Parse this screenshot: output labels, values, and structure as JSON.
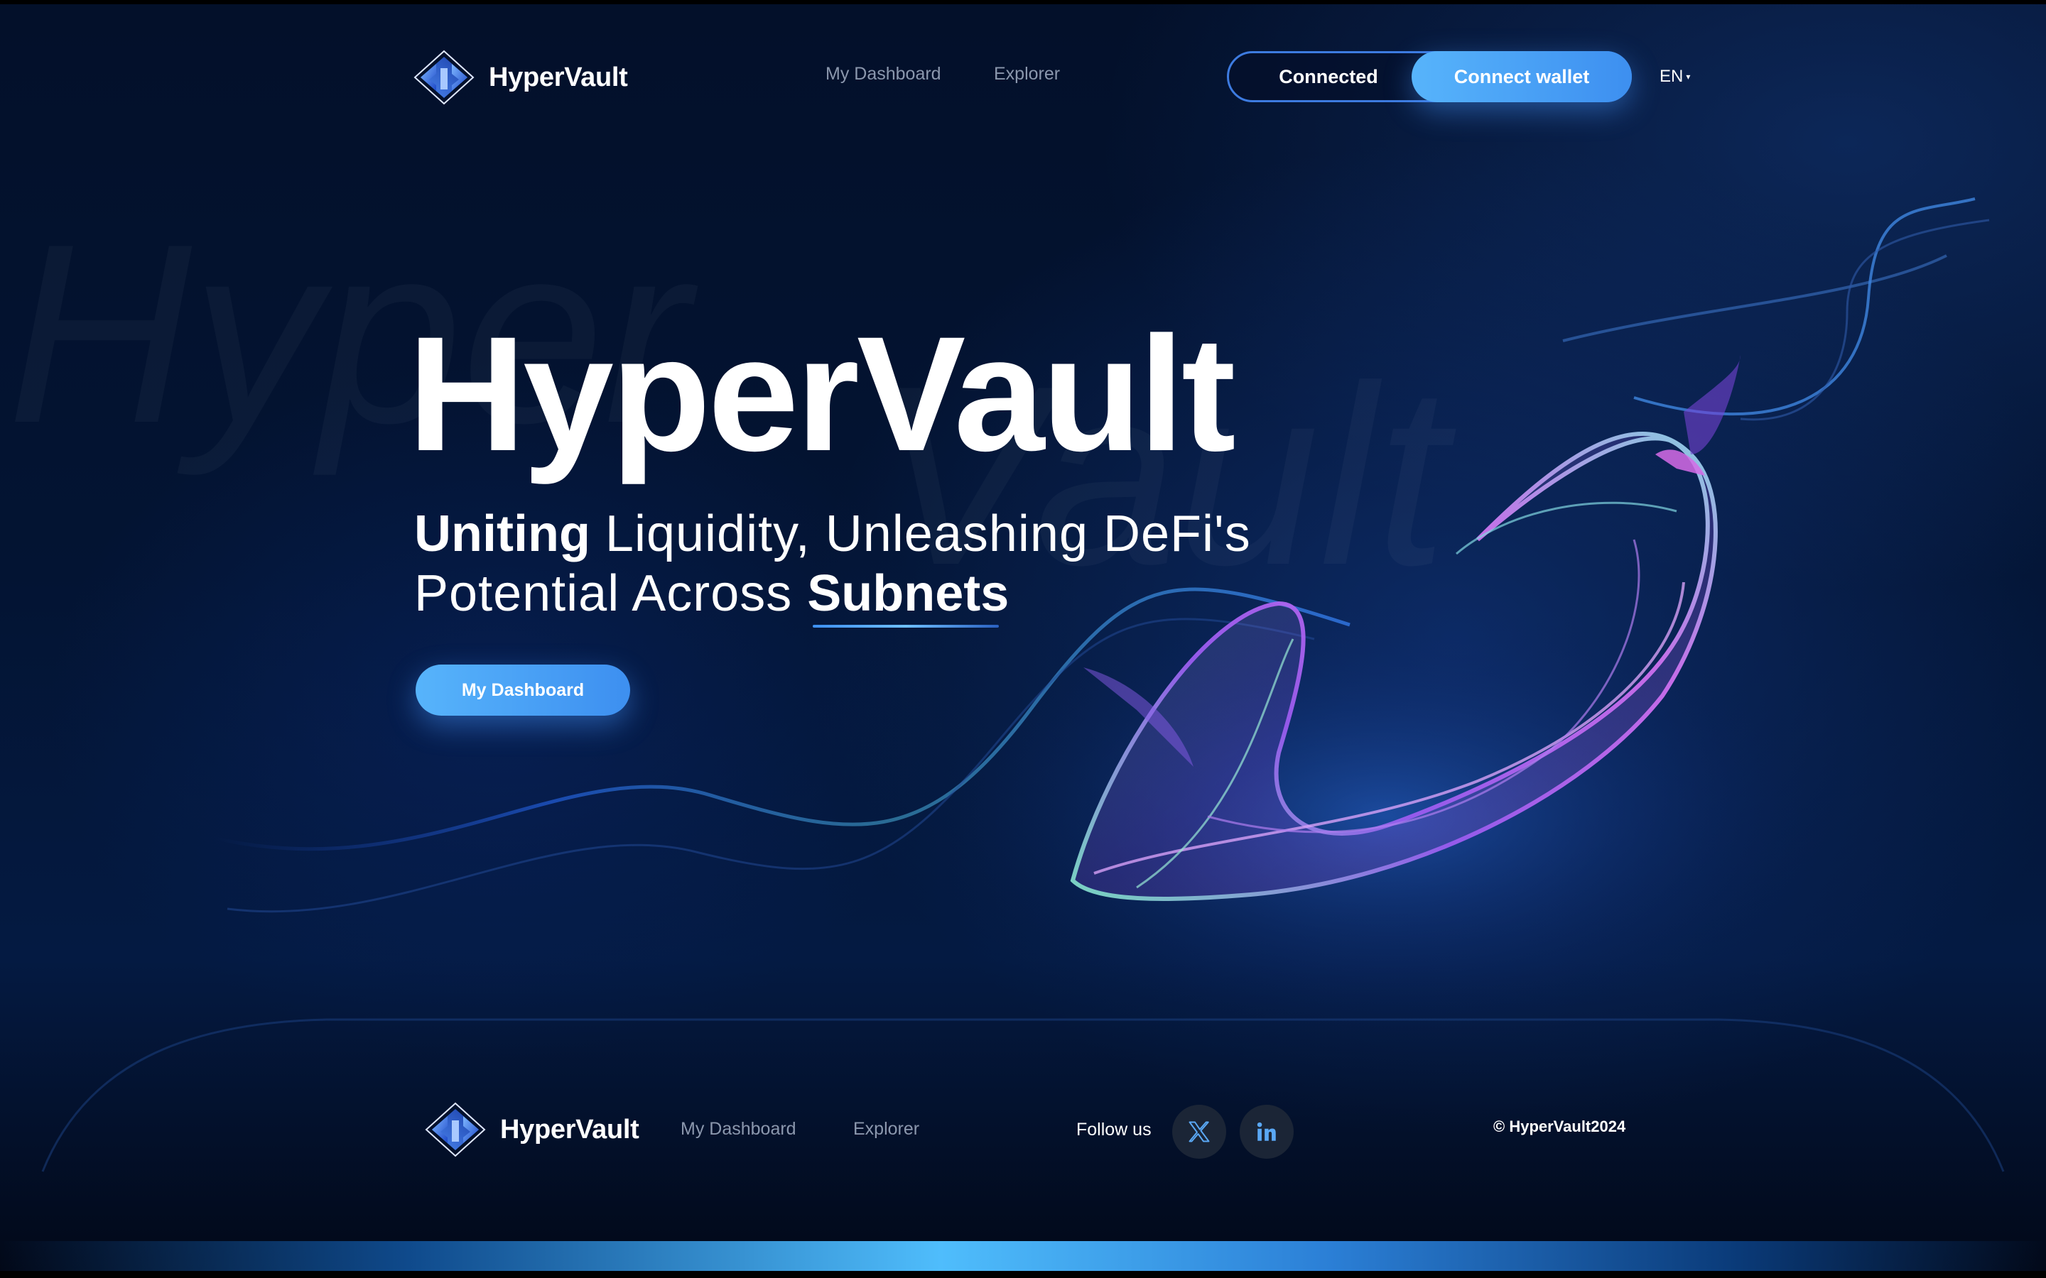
{
  "brand": {
    "name": "HyperVault"
  },
  "header": {
    "nav": [
      {
        "label": "My Dashboard"
      },
      {
        "label": "Explorer"
      }
    ],
    "wallet": {
      "connected_label": "Connected",
      "connect_label": "Connect wallet"
    },
    "language": "EN"
  },
  "hero": {
    "watermark_1": "Hyper",
    "watermark_2": "Vault",
    "title": "HyperVault",
    "subtitle": {
      "bold_1": "Uniting",
      "text_1": " Liquidity, Unleashing DeFi's",
      "text_2": "Potential Across ",
      "bold_2": "Subnets"
    },
    "cta_label": "My Dashboard"
  },
  "footer": {
    "brand": "HyperVault",
    "nav": [
      {
        "label": "My Dashboard"
      },
      {
        "label": "Explorer"
      }
    ],
    "follow_label": "Follow us",
    "social": [
      {
        "icon": "x-twitter-icon"
      },
      {
        "icon": "linkedin-icon"
      }
    ],
    "copyright": "© HyperVault2024"
  },
  "colors": {
    "accent": "#4aa6f8",
    "background": "#031433",
    "nav_text": "#8b97ad"
  }
}
